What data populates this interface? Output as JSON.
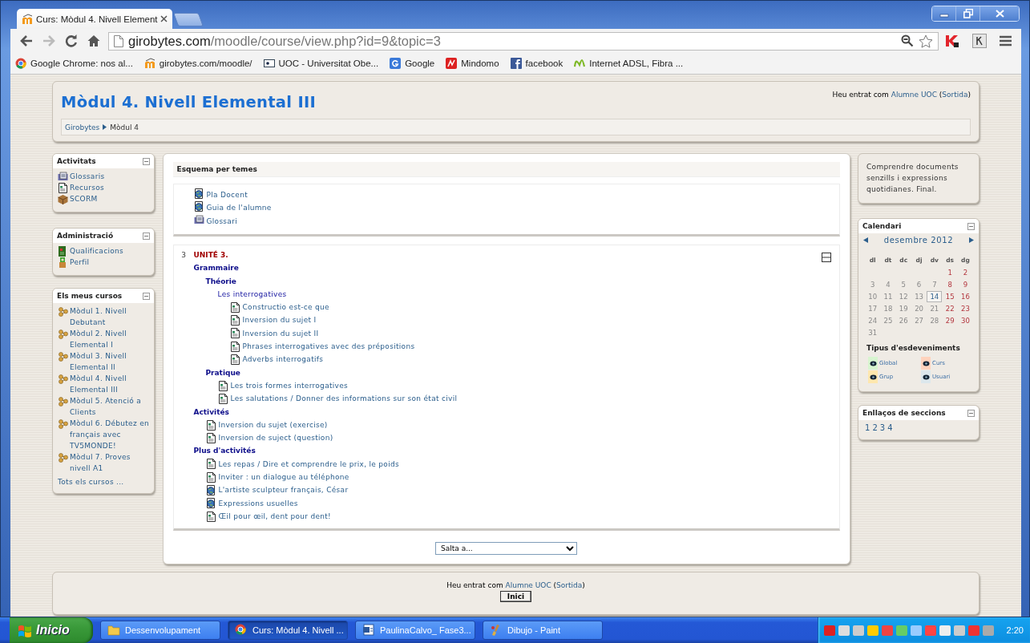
{
  "browser": {
    "tab": {
      "title": "Curs: Mòdul 4. Nivell Element"
    },
    "url": {
      "host": "girobytes.com",
      "path": "/moodle/course/view.php?id=9&topic=3"
    },
    "bookmarks": [
      {
        "label": "Google Chrome: nos al...",
        "kind": "chrome"
      },
      {
        "label": "girobytes.com/moodle/",
        "kind": "moodle"
      },
      {
        "label": "UOC - Universitat Obe...",
        "kind": "uoc"
      },
      {
        "label": "Google",
        "kind": "google"
      },
      {
        "label": "Mindomo",
        "kind": "mindomo"
      },
      {
        "label": "facebook",
        "kind": "facebook"
      },
      {
        "label": "Internet ADSL, Fibra ...",
        "kind": "movistar"
      }
    ]
  },
  "header": {
    "title": "Mòdul 4. Nivell Elemental III",
    "login": [
      {
        "kind": "text",
        "text": "Heu entrat com "
      },
      {
        "kind": "link",
        "text": "Alumne UOC"
      },
      {
        "kind": "text",
        "text": " ("
      },
      {
        "kind": "link",
        "text": "Sortida"
      },
      {
        "kind": "text",
        "text": ")"
      }
    ],
    "breadcrumb": [
      "Girobytes",
      "Mòdul 4"
    ]
  },
  "left_blocks": [
    {
      "title": "Activitats",
      "items": [
        {
          "label": "Glossaris",
          "kind": "glossary"
        },
        {
          "label": "Recursos",
          "kind": "page"
        },
        {
          "label": "SCORM",
          "kind": "scorm"
        }
      ]
    },
    {
      "title": "Administració",
      "items": [
        {
          "label": "Qualificacions",
          "kind": "grades"
        },
        {
          "label": "Perfil",
          "kind": "profile"
        }
      ]
    },
    {
      "title": "Els meus cursos",
      "items": [
        {
          "label": "Mòdul 1. Nivell Debutant",
          "kind": "course"
        },
        {
          "label": "Mòdul 2. Nivell Elemental I",
          "kind": "course"
        },
        {
          "label": "Mòdul 3. Nivell Elemental II",
          "kind": "course"
        },
        {
          "label": "Mòdul 4. Nivell Elemental III",
          "kind": "course"
        },
        {
          "label": "Mòdul 5. Atenció a Clients",
          "kind": "course"
        },
        {
          "label": "Mòdul 6. Débutez en français avec TV5MONDE!",
          "kind": "course"
        },
        {
          "label": "Mòdul 7. Proves nivell A1",
          "kind": "course"
        }
      ],
      "footer": "Tots els cursos ..."
    }
  ],
  "center": {
    "heading": "Esquema per temes",
    "section0": [
      {
        "label": "Pla Docent",
        "kind": "url"
      },
      {
        "label": "Guia de l'alumne",
        "kind": "url"
      },
      {
        "label": "Glossari",
        "kind": "glossary"
      }
    ],
    "section": {
      "number": "3",
      "title": "UNITÉ 3.",
      "outline": [
        {
          "kind": "heading",
          "label": "Grammaire",
          "children": [
            {
              "kind": "heading",
              "label": "Théorie",
              "children": [
                {
                  "kind": "label",
                  "label": "Les interrogatives",
                  "children": [
                    {
                      "kind": "page",
                      "label": "Constructio est-ce que"
                    },
                    {
                      "kind": "page",
                      "label": "Inversion du sujet I"
                    },
                    {
                      "kind": "page",
                      "label": "Inversion du sujet II"
                    },
                    {
                      "kind": "page",
                      "label": "Phrases interrogatives avec des prépositions"
                    },
                    {
                      "kind": "page",
                      "label": "Adverbs interrogatifs"
                    }
                  ]
                }
              ]
            },
            {
              "kind": "heading",
              "label": "Pratique",
              "children": [
                {
                  "kind": "page",
                  "label": "Les trois formes interrogatives"
                },
                {
                  "kind": "page",
                  "label": "Les salutations / Donner des informations sur son état civil"
                }
              ]
            }
          ]
        },
        {
          "kind": "heading",
          "label": "Activités",
          "children": [
            {
              "kind": "page",
              "label": "Inversion du sujet (exercise)"
            },
            {
              "kind": "page",
              "label": "Inversion de suject (question)"
            }
          ]
        },
        {
          "kind": "heading",
          "label": "Plus d'activités",
          "children": [
            {
              "kind": "page",
              "label": "Les repas / Dire et comprendre le prix, le poids"
            },
            {
              "kind": "page",
              "label": "Inviter : un dialogue au téléphone"
            },
            {
              "kind": "url",
              "label": "L'artiste sculpteur français, César"
            },
            {
              "kind": "url",
              "label": "Expressions usuelles"
            },
            {
              "kind": "page",
              "label": "Œil pour œil, dent pour dent!"
            }
          ]
        }
      ]
    },
    "jump_menu": {
      "value": "Salta a..."
    }
  },
  "right": {
    "summary": "Comprendre documents senzills i expressions quotidianes. Final.",
    "calendar": {
      "title": "Calendari",
      "month": "desembre 2012",
      "weekdays": [
        "dl",
        "dt",
        "dc",
        "dj",
        "dv",
        "ds",
        "dg"
      ],
      "weeks": [
        {
          "kind": "end",
          "days": [
            {
              "day": "1",
              "weekend": true,
              "selected": false
            },
            {
              "day": "2",
              "weekend": true,
              "selected": false
            }
          ]
        },
        {
          "kind": "start",
          "days": [
            {
              "day": "3",
              "weekend": false,
              "selected": false
            },
            {
              "day": "4",
              "weekend": false,
              "selected": false
            },
            {
              "day": "5",
              "weekend": false,
              "selected": false
            },
            {
              "day": "6",
              "weekend": false,
              "selected": false
            },
            {
              "day": "7",
              "weekend": false,
              "selected": false
            },
            {
              "day": "8",
              "weekend": true,
              "selected": false
            },
            {
              "day": "9",
              "weekend": true,
              "selected": false
            }
          ]
        },
        {
          "kind": "start",
          "days": [
            {
              "day": "10",
              "weekend": false,
              "selected": false
            },
            {
              "day": "11",
              "weekend": false,
              "selected": false
            },
            {
              "day": "12",
              "weekend": false,
              "selected": false
            },
            {
              "day": "13",
              "weekend": false,
              "selected": false
            },
            {
              "day": "14",
              "weekend": false,
              "selected": true
            },
            {
              "day": "15",
              "weekend": true,
              "selected": false
            },
            {
              "day": "16",
              "weekend": true,
              "selected": false
            }
          ]
        },
        {
          "kind": "start",
          "days": [
            {
              "day": "17",
              "weekend": false,
              "selected": false
            },
            {
              "day": "18",
              "weekend": false,
              "selected": false
            },
            {
              "day": "19",
              "weekend": false,
              "selected": false
            },
            {
              "day": "20",
              "weekend": false,
              "selected": false
            },
            {
              "day": "21",
              "weekend": false,
              "selected": false
            },
            {
              "day": "22",
              "weekend": true,
              "selected": false
            },
            {
              "day": "23",
              "weekend": true,
              "selected": false
            }
          ]
        },
        {
          "kind": "start",
          "days": [
            {
              "day": "24",
              "weekend": false,
              "selected": false
            },
            {
              "day": "25",
              "weekend": false,
              "selected": false
            },
            {
              "day": "26",
              "weekend": false,
              "selected": false
            },
            {
              "day": "27",
              "weekend": false,
              "selected": false
            },
            {
              "day": "28",
              "weekend": false,
              "selected": false
            },
            {
              "day": "29",
              "weekend": true,
              "selected": false
            },
            {
              "day": "30",
              "weekend": true,
              "selected": false
            }
          ]
        },
        {
          "kind": "start",
          "days": [
            {
              "day": "31",
              "weekend": false,
              "selected": false
            }
          ]
        }
      ],
      "legend_title": "Tipus d'esdeveniments",
      "event_types": [
        {
          "label": "Global",
          "color": "#d8f5d0"
        },
        {
          "label": "Curs",
          "color": "#ffd3bd"
        },
        {
          "label": "Grup",
          "color": "#fee7ae"
        },
        {
          "label": "Usuari",
          "color": "#dce7ec"
        }
      ]
    },
    "section_links": {
      "title": "Enllaços de seccions",
      "links": [
        "1",
        "2",
        "3",
        "4"
      ]
    }
  },
  "footer": {
    "login": [
      {
        "kind": "text",
        "text": "Heu entrat com "
      },
      {
        "kind": "link",
        "text": "Alumne UOC"
      },
      {
        "kind": "text",
        "text": " ("
      },
      {
        "kind": "link",
        "text": "Sortida"
      },
      {
        "kind": "text",
        "text": ")"
      }
    ],
    "button": "Inici"
  },
  "taskbar": {
    "start": "Inicio",
    "tasks": [
      {
        "label": "Dessenvolupament",
        "kind": "folder",
        "selected": false
      },
      {
        "label": "Curs: Mòdul 4. Nivell ...",
        "kind": "chrome",
        "selected": true
      },
      {
        "label": "PaulinaCalvo_ Fase3...",
        "kind": "word",
        "selected": false
      },
      {
        "label": "Dibujo - Paint",
        "kind": "paint",
        "selected": false
      }
    ],
    "clock": "2:20"
  }
}
